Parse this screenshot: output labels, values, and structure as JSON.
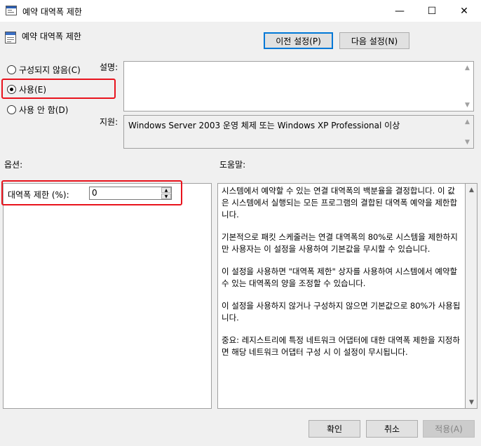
{
  "window": {
    "title": "예약 대역폭 제한",
    "minimize": "—",
    "maximize": "☐",
    "close": "✕"
  },
  "policy": {
    "name": "예약 대역폭 제한"
  },
  "nav": {
    "prev_label": "이전 설정(P)",
    "next_label": "다음 설정(N)"
  },
  "state_options": {
    "not_configured": "구성되지 않음(C)",
    "enabled": "사용(E)",
    "disabled": "사용 안 함(D)",
    "selected": "enabled"
  },
  "labels": {
    "comment": "설명:",
    "supported": "지원:",
    "options": "옵션:",
    "help": "도움말:"
  },
  "comment_value": "",
  "supported_value": "Windows Server 2003 운영 체제 또는 Windows XP Professional 이상",
  "options": {
    "bandwidth_label": "대역폭 제한 (%):",
    "bandwidth_value": "0"
  },
  "help_paragraphs": [
    "시스템에서 예약할 수 있는 연결 대역폭의 백분율을 결정합니다. 이 값은 시스템에서 실행되는 모든 프로그램의 결합된 대역폭 예약을 제한합니다.",
    "기본적으로 패킷 스케줄러는 연결 대역폭의 80%로 시스템을 제한하지만 사용자는 이 설정을 사용하여 기본값을 무시할 수 있습니다.",
    "이 설정을 사용하면 \"대역폭 제한\" 상자를 사용하여 시스템에서 예약할 수 있는 대역폭의 양을 조정할 수 있습니다.",
    "이 설정을 사용하지 않거나 구성하지 않으면 기본값으로 80%가 사용됩니다.",
    "중요: 레지스트리에 특정 네트워크 어댑터에 대한 대역폭 제한을 지정하면 해당 네트워크 어댑터 구성 시 이 설정이 무시됩니다."
  ],
  "buttons": {
    "ok": "확인",
    "cancel": "취소",
    "apply": "적용(A)"
  },
  "colors": {
    "highlight": "#e8131d",
    "focus": "#0078d7"
  }
}
